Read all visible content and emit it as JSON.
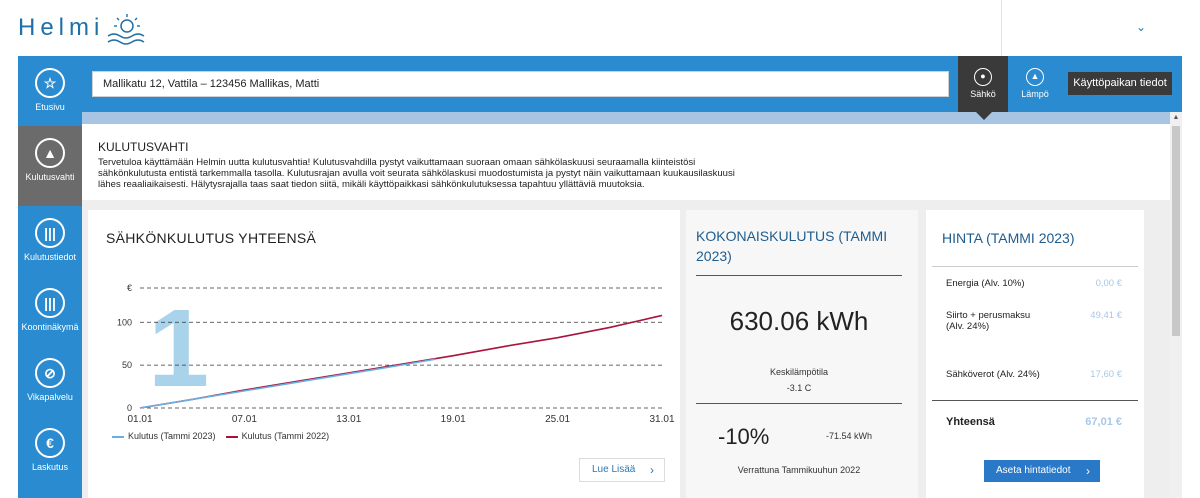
{
  "app": {
    "logo": "Helmi"
  },
  "sidebar": {
    "items": [
      {
        "label": "Etusivu",
        "icon": "star-icon"
      },
      {
        "label": "Kulutusvahti",
        "icon": "bell-icon",
        "active": true
      },
      {
        "label": "Kulutustiedot",
        "icon": "bar-chart-icon"
      },
      {
        "label": "Koontinäkymä",
        "icon": "bar-chart-icon"
      },
      {
        "label": "Vikapalvelu",
        "icon": "no-power-icon"
      },
      {
        "label": "Laskutus",
        "icon": "euro-icon"
      }
    ]
  },
  "header": {
    "address": "Mallikatu 12, Vattila – 123456 Mallikas, Matti",
    "tabs": [
      {
        "label": "Sähkö",
        "icon": "plug-icon",
        "active": true
      },
      {
        "label": "Lämpö",
        "icon": "heat-icon"
      }
    ],
    "usage_button": "Käyttöpaikan tiedot"
  },
  "intro": {
    "title": "KULUTUSVAHTI",
    "lines": [
      "Tervetuloa käyttämään Helmin uutta kulutusvahtia! Kulutusvahdilla pystyt vaikuttamaan suoraan omaan sähkölaskuusi seuraamalla kiinteistösi",
      "sähkönkulutusta entistä tarkemmalla tasolla. Kulutusrajan avulla voit seurata sähkölaskusi muodostumista ja pystyt näin vaikuttamaan kuukausilaskuusi",
      "lähes reaaliaikaisesti. Hälytysrajalla taas saat tiedon siitä, mikäli käyttöpaikkasi sähkönkulutuksessa tapahtuu yllättäviä muutoksia."
    ]
  },
  "chart_card": {
    "title": "SÄHKÖNKULUTUS YHTEENSÄ",
    "more_button": "Lue Lisää",
    "step_number": "1"
  },
  "chart_data": {
    "type": "line",
    "title": "SÄHKÖNKULUTUS YHTEENSÄ",
    "y_unit_label": "€",
    "yticks": [
      0,
      50,
      100
    ],
    "ylim": [
      0,
      140
    ],
    "x_tick_labels": [
      "01.01",
      "07.01",
      "13.01",
      "19.01",
      "25.01",
      "31.01"
    ],
    "xlim": [
      1,
      31
    ],
    "grid": true,
    "legend_position": "bottom-left",
    "series": [
      {
        "name": "Kulutus (Tammi 2023)",
        "color": "#6aaee0",
        "x": [
          1,
          4,
          7,
          10,
          13,
          16,
          18
        ],
        "y": [
          0,
          10,
          20,
          30,
          40,
          50,
          57
        ]
      },
      {
        "name": "Kulutus (Tammi 2022)",
        "color": "#a8143c",
        "x": [
          1,
          4,
          7,
          10,
          13,
          16,
          19,
          22,
          25,
          28,
          31
        ],
        "y": [
          0,
          10,
          21,
          31,
          41,
          51,
          61,
          72,
          82,
          94,
          108
        ]
      }
    ]
  },
  "kpi": {
    "title": "KOKONAISKULUTUS (TAMMI 2023)",
    "value": "630.06 kWh",
    "temp_label": "Keskilämpötila",
    "temp_value": "-3.1 C",
    "percent": "-10%",
    "delta": "-71.54 kWh",
    "compare": "Verrattuna Tammikuuhun 2022"
  },
  "price": {
    "title": "HINTA (TAMMI 2023)",
    "rows": [
      {
        "label": "Energia (Alv. 10%)",
        "value": "0,00 €"
      },
      {
        "label": "Siirto + perusmaksu (Alv. 24%)",
        "value": "49,41 €"
      },
      {
        "label": "Sähköverot (Alv. 24%)",
        "value": "17,60 €"
      }
    ],
    "total_label": "Yhteensä",
    "total_value": "67,01 €",
    "button": "Aseta hintatiedot"
  },
  "colors": {
    "brand_blue": "#2a8bd0",
    "dark": "#3a3a3a",
    "accent_light": "#a7c4e2",
    "series_2023": "#6aaee0",
    "series_2022": "#a8143c"
  }
}
